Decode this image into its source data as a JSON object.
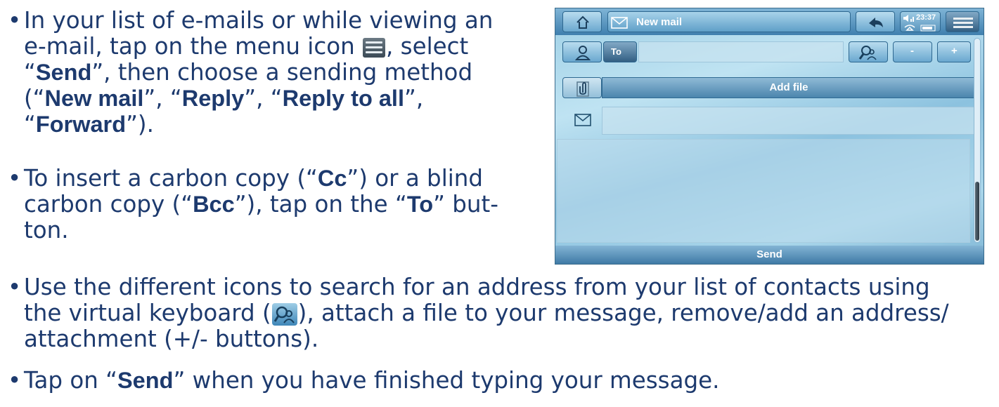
{
  "bullets": {
    "b1": {
      "t1": "In your list of e-mails or while viewing an",
      "t2": "e-mail, tap on the menu icon ",
      "t3": ", select",
      "q1": "“",
      "send": "Send",
      "q2": "”, then choose a sending method",
      "p1": "(“",
      "new_mail": "New mail",
      "c1": "”, “",
      "reply": "Reply",
      "c2": "”, “",
      "reply_all": "Reply to all",
      "c3": "”,",
      "q3": "“",
      "forward": "Forward",
      "q4": "”)."
    },
    "b2": {
      "t1": "To insert a carbon copy (“",
      "cc": "Cc",
      "t2": "”) or a blind",
      "t3": "carbon copy (“",
      "bcc": "Bcc",
      "t4": "”), tap on the “",
      "to": "To",
      "t5": "” but-",
      "t6": "ton."
    },
    "b3": {
      "t1": "Use the different icons to search for an address from your list of contacts using",
      "t2": "the virtual keyboard (",
      "t3": "), attach a file to your message, remove/add an address/",
      "t4": "attachment (+/- buttons)."
    },
    "b4": {
      "t1": "Tap on “",
      "send": "Send",
      "t2": "” when you have finished typing your message."
    },
    "dot": "•"
  },
  "device": {
    "title": "New mail",
    "time": "23:37",
    "to_label": "To",
    "minus": "-",
    "plus": "+",
    "add_file": "Add file",
    "send": "Send"
  },
  "icons": [
    "home-icon",
    "mail-icon",
    "back-icon",
    "status-icon",
    "menu-icon",
    "contact-icon",
    "search-contact-icon",
    "attachment-icon"
  ]
}
